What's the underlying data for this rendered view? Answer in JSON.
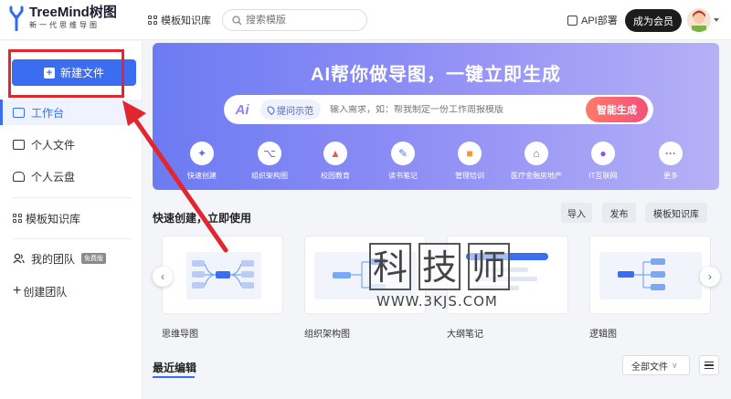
{
  "header": {
    "logo_title": "TreeMind树图",
    "logo_subtitle": "新一代思维导图",
    "template_library_label": "模板知识库",
    "search_placeholder": "搜索模版",
    "api_label": "API部署",
    "member_button": "成为会员"
  },
  "sidebar": {
    "new_file_label": "新建文件",
    "items": [
      {
        "label": "工作台",
        "active": true,
        "icon": "monitor-icon"
      },
      {
        "label": "个人文件",
        "active": false,
        "icon": "folder-icon"
      },
      {
        "label": "个人云盘",
        "active": false,
        "icon": "cloud-drive-icon"
      },
      {
        "label": "模板知识库",
        "active": false,
        "icon": "grid-icon"
      },
      {
        "label": "我的团队",
        "active": false,
        "icon": "team-icon",
        "badge": "免费版"
      },
      {
        "label": "创建团队",
        "active": false,
        "icon": "plus-icon"
      }
    ]
  },
  "banner": {
    "title": "AI帮你做导图，一键立即生成",
    "example_chip": "提问示范",
    "input_placeholder": "输入需求，如：帮我制定一份工作周报模版",
    "generate_button": "智能生成",
    "ai_logo": "Ai",
    "categories": [
      {
        "label": "快速创建",
        "icon": "rocket-icon",
        "color": "#5b6cf0"
      },
      {
        "label": "组织架构图",
        "icon": "org-chart-icon",
        "color": "#8a55e8"
      },
      {
        "label": "校园教育",
        "icon": "graduation-cap-icon",
        "color": "#e45b5b"
      },
      {
        "label": "读书笔记",
        "icon": "notebook-icon",
        "color": "#4b7cf3"
      },
      {
        "label": "管理培训",
        "icon": "briefcase-icon",
        "color": "#f0963a"
      },
      {
        "label": "医疗金融房地产",
        "icon": "building-icon",
        "color": "#8a55e8"
      },
      {
        "label": "IT互联网",
        "icon": "globe-icon",
        "color": "#8a55e8"
      },
      {
        "label": "更多",
        "icon": "more-icon",
        "color": "#8a55e8"
      }
    ]
  },
  "quick_create": {
    "title": "快速创建，立即使用",
    "import_label": "导入",
    "publish_label": "发布",
    "template_label": "模板知识库",
    "cards": [
      {
        "label": "思维导图"
      },
      {
        "label": "组织架构图"
      },
      {
        "label": "大纲笔记"
      },
      {
        "label": "逻辑图"
      }
    ]
  },
  "recent": {
    "tab_label": "最近编辑",
    "filter_value": "全部文件"
  },
  "watermark": {
    "chars": [
      "科",
      "技",
      "师"
    ],
    "url": "WWW.3KJS.COM"
  },
  "colors": {
    "accent": "#3a6df0",
    "annotation_red": "#e1262f"
  }
}
